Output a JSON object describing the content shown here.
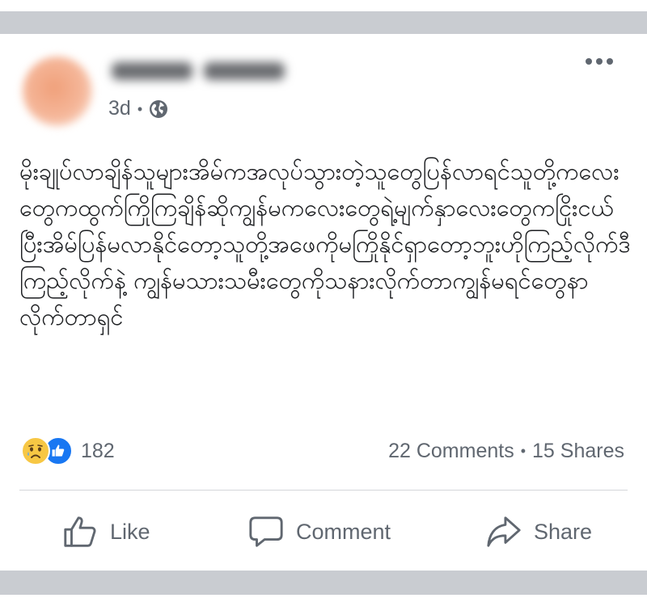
{
  "post": {
    "timestamp": "3d",
    "separator": "•",
    "visibility_icon": "globe-icon",
    "menu_icon": "more-options-icon",
    "body": "မိုးချုပ်လာချိန်သူများအိမ်ကအလုပ်သွားတဲ့သူတွေပြန်လာရင်သူတို့ကလေးတွေကထွက်ကြိုကြချိန်ဆိုကျွန်မကလေးတွေရဲ့မျက်နှာလေးတွေကငြိုးငယ်ပြီးအိမ်ပြန်မလာနိုင်တော့သူတို့အဖေကိုမကြိုနိုင်ရှာတော့ဘူးဟိုကြည့်လိုက်ဒီကြည့်လိုက်နဲ့ ကျွန်မသားသမီးတွေကိုသနားလိုက်တာကျွန်မရင်တွေနာလိုက်တာရှင်"
  },
  "stats": {
    "reaction_icons": [
      "sad-reaction-icon",
      "like-reaction-icon"
    ],
    "reaction_count": "182",
    "comments": "22 Comments",
    "separator": "•",
    "shares": "15 Shares"
  },
  "actions": {
    "like": "Like",
    "comment": "Comment",
    "share": "Share"
  },
  "colors": {
    "text_secondary": "#606770",
    "like_blue": "#1877f2",
    "sad_yellow": "#f7c744",
    "frame_gray": "#c9ccd1"
  }
}
